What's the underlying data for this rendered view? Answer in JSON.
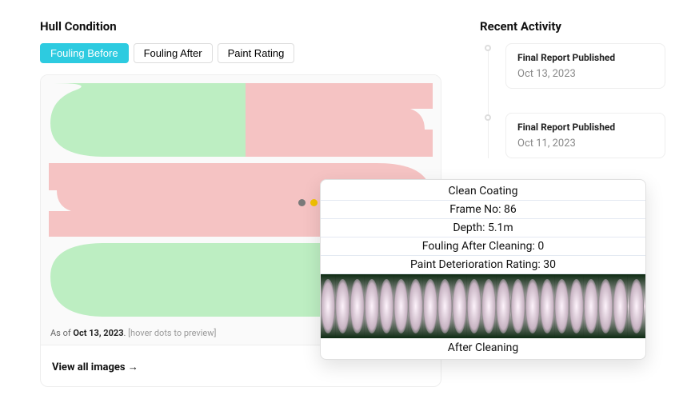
{
  "hull": {
    "title": "Hull Condition",
    "tabs": [
      "Fouling Before",
      "Fouling After",
      "Paint Rating"
    ],
    "active_tab": "Fouling Before",
    "as_of_prefix": "As of ",
    "as_of_date": "Oct 13, 2023",
    "as_of_suffix": ". ",
    "hover_hint": "[hover dots to preview]",
    "footer_link": "View all images →",
    "colors": {
      "green": "#bdeec2",
      "red": "#f5c3c3"
    }
  },
  "activity": {
    "title": "Recent Activity",
    "items": [
      {
        "title": "Final Report Published",
        "date": "Oct 13, 2023"
      },
      {
        "title": "Final Report Published",
        "date": "Oct 11, 2023"
      }
    ]
  },
  "tooltip": {
    "title": "Clean Coating",
    "frame_label": "Frame No: ",
    "frame_value": "86",
    "depth_label": "Depth: ",
    "depth_value": "5.1m",
    "fouling_label": "Fouling After Cleaning: ",
    "fouling_value": "0",
    "paint_label": "Paint Deterioration Rating: ",
    "paint_value": "30",
    "caption": "After Cleaning"
  }
}
